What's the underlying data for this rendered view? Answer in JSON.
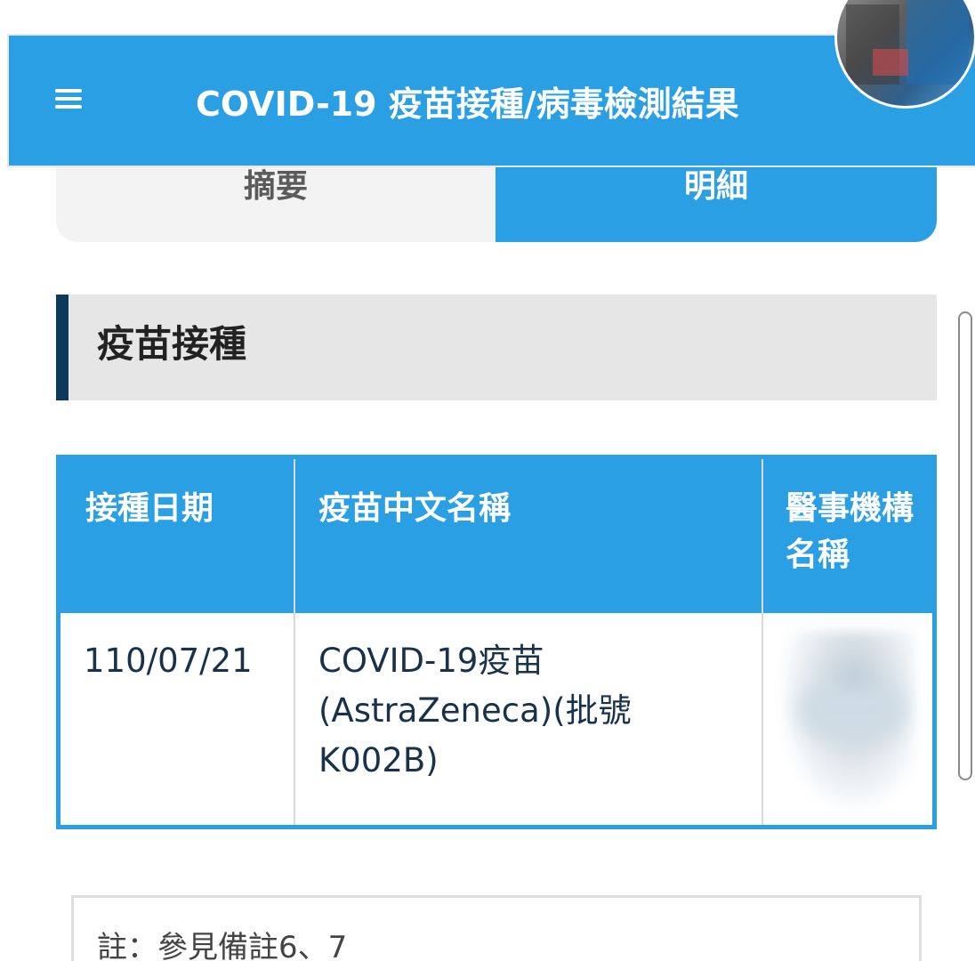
{
  "appbar": {
    "title": "COVID-19 疫苗接種/病毒檢測結果",
    "menu_icon": "hamburger-menu-icon",
    "bg_color": "#2b9fe4"
  },
  "tabs": [
    {
      "label": "摘要",
      "active": false
    },
    {
      "label": "明細",
      "active": true
    }
  ],
  "section": {
    "title": "疫苗接種",
    "accent_color": "#0c3a5c"
  },
  "table": {
    "headers": {
      "date": "接種日期",
      "vaccine_name": "疫苗中文名稱",
      "institution": "醫事機構名稱"
    },
    "rows": [
      {
        "date": "110/07/21",
        "vaccine_name": "COVID-19疫苗(AstraZeneca)(批號K002B)",
        "institution": ""
      }
    ]
  },
  "note": {
    "text": "註：參見備註6、7"
  }
}
